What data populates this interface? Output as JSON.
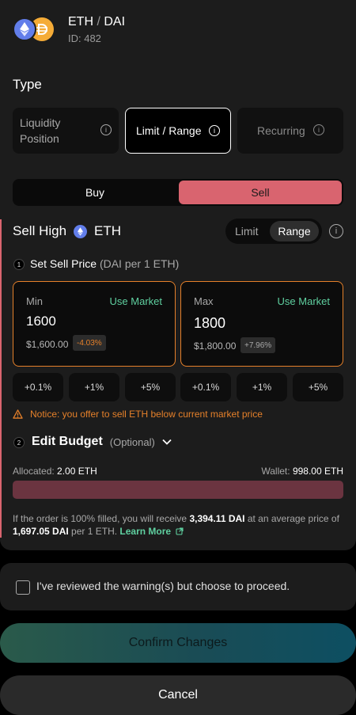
{
  "header": {
    "base_token": "ETH",
    "separator": "/",
    "quote_token": "DAI",
    "pair_id": "ID: 482"
  },
  "type_section": {
    "label": "Type",
    "options": [
      {
        "label_line1": "Liquidity",
        "label_line2": "Position"
      },
      {
        "label": "Limit / Range"
      },
      {
        "label": "Recurring"
      }
    ],
    "selected": "Limit / Range"
  },
  "side": {
    "buy_label": "Buy",
    "sell_label": "Sell",
    "selected": "Sell",
    "sell_color": "#d9646f"
  },
  "sell_high": {
    "title": "Sell High",
    "token": "ETH",
    "toggle_limit": "Limit",
    "toggle_range": "Range",
    "toggle_selected": "Range"
  },
  "step1": {
    "number": "1",
    "title": "Set Sell Price",
    "subtitle": "(DAI per 1 ETH)"
  },
  "min_box": {
    "label": "Min",
    "market_link": "Use Market",
    "value": "1600",
    "usd": "$1,600.00",
    "pct": "-4.03%"
  },
  "max_box": {
    "label": "Max",
    "market_link": "Use Market",
    "value": "1800",
    "usd": "$1,800.00",
    "pct": "+7.96%"
  },
  "pct_buttons": {
    "min": [
      "+0.1%",
      "+1%",
      "+5%"
    ],
    "max": [
      "+0.1%",
      "+1%",
      "+5%"
    ]
  },
  "notice": "Notice: you offer to sell ETH below current market price",
  "step2": {
    "number": "2",
    "title": "Edit Budget",
    "optional": "(Optional)"
  },
  "budget": {
    "allocated_label": "Allocated:",
    "allocated_value": "2.00 ETH",
    "wallet_label": "Wallet:",
    "wallet_value": "998.00 ETH"
  },
  "fill_note": {
    "part1": "If the order is 100% filled, you will receive ",
    "receive": "3,394.11 DAI",
    "part2": " at an average price of ",
    "price": "1,697.05 DAI",
    "part3": " per 1 ETH. ",
    "learn_more": "Learn More"
  },
  "warning_checkbox": "I've reviewed the warning(s) but choose to proceed.",
  "confirm_button": "Confirm Changes",
  "cancel_button": "Cancel",
  "colors": {
    "accent_green": "#5fd0a0",
    "warning_orange": "#e5802a",
    "sell_red": "#d9646f"
  }
}
